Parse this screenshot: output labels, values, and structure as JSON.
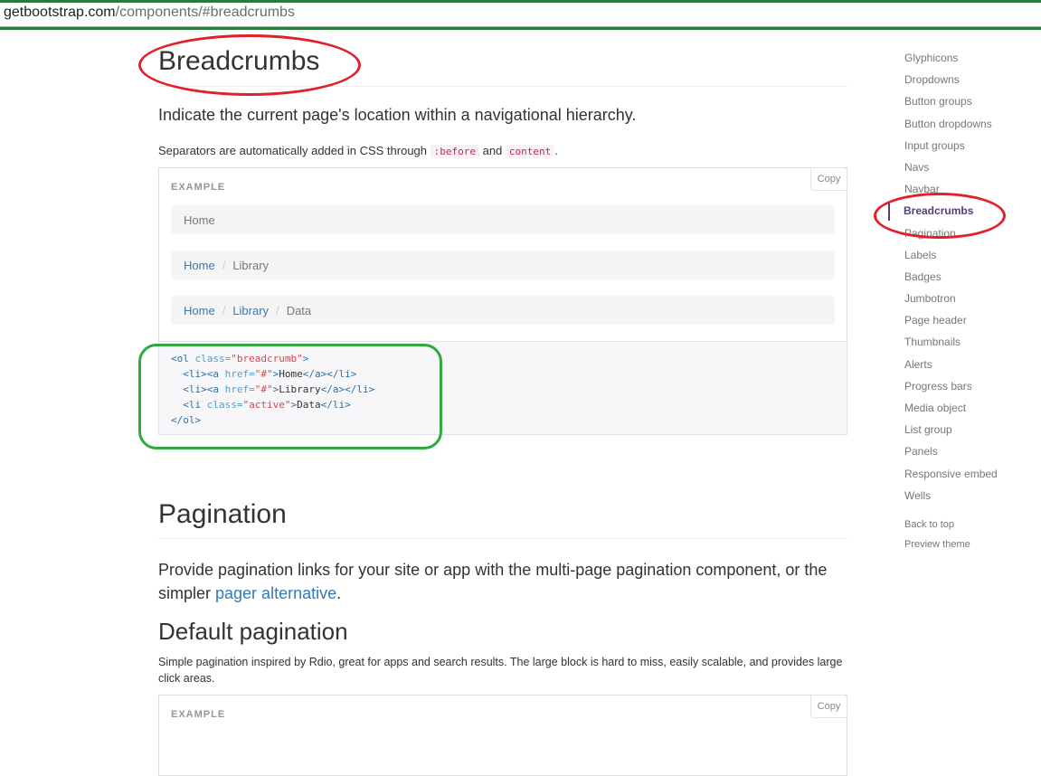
{
  "url": {
    "host": "getbootstrap.com",
    "path": "/components/#breadcrumbs"
  },
  "breadcrumbs_section": {
    "title": "Breadcrumbs",
    "lead": "Indicate the current page's location within a navigational hierarchy.",
    "sep_text_before": "Separators are automatically added in CSS through ",
    "code1": ":before",
    "sep_text_and": " and ",
    "code2": "content",
    "sep_text_after": ".",
    "example_label": "EXAMPLE",
    "copy_label": "Copy",
    "breadcrumb_rows": [
      {
        "links": [],
        "active": "Home"
      },
      {
        "links": [
          "Home"
        ],
        "active": "Library"
      },
      {
        "links": [
          "Home",
          "Library"
        ],
        "active": "Data"
      }
    ],
    "separator": "/",
    "code_lines": [
      "<ol class=\"breadcrumb\">",
      "  <li><a href=\"#\">Home</a></li>",
      "  <li><a href=\"#\">Library</a></li>",
      "  <li class=\"active\">Data</li>",
      "</ol>"
    ]
  },
  "pagination_section": {
    "title": "Pagination",
    "lead_before": "Provide pagination links for your site or app with the multi-page pagination component, or the simpler ",
    "lead_link": "pager alternative",
    "lead_after": ".",
    "subtitle": "Default pagination",
    "description": "Simple pagination inspired by Rdio, great for apps and search results. The large block is hard to miss, easily scalable, and provides large click areas.",
    "example_label": "EXAMPLE",
    "copy_label": "Copy"
  },
  "sidenav": {
    "items": [
      "Glyphicons",
      "Dropdowns",
      "Button groups",
      "Button dropdowns",
      "Input groups",
      "Navs",
      "Navbar",
      "Breadcrumbs",
      "Pagination",
      "Labels",
      "Badges",
      "Jumbotron",
      "Page header",
      "Thumbnails",
      "Alerts",
      "Progress bars",
      "Media object",
      "List group",
      "Panels",
      "Responsive embed",
      "Wells"
    ],
    "active_index": 7,
    "back_to_top": "Back to top",
    "preview_theme": "Preview theme"
  },
  "annotation_colors": {
    "red": "#e0202a",
    "green": "#2eaa3e"
  }
}
